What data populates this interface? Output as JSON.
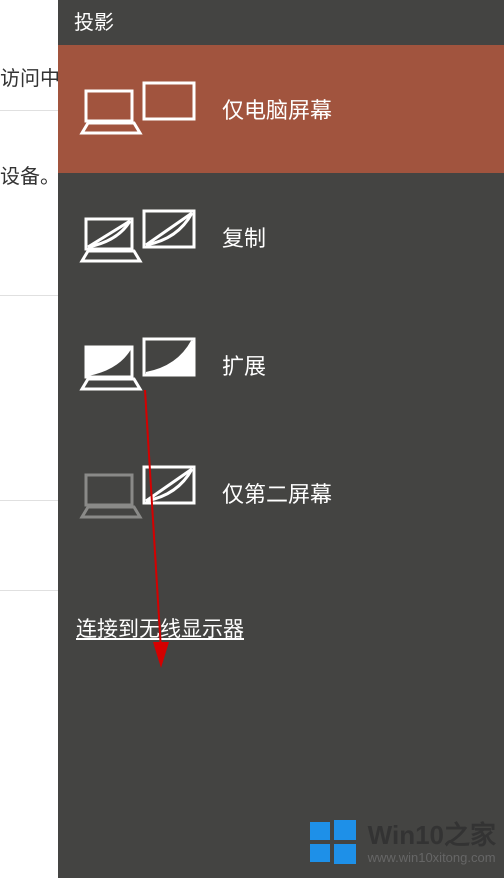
{
  "background": {
    "line1": "访问中",
    "line2": "设备。"
  },
  "panel": {
    "title": "投影",
    "options": [
      {
        "label": "仅电脑屏幕",
        "selected": true
      },
      {
        "label": "复制",
        "selected": false
      },
      {
        "label": "扩展",
        "selected": false
      },
      {
        "label": "仅第二屏幕",
        "selected": false
      }
    ],
    "wireless_link": "连接到无线显示器"
  },
  "watermark": {
    "title": "Win10之家",
    "url": "www.win10xitong.com"
  }
}
